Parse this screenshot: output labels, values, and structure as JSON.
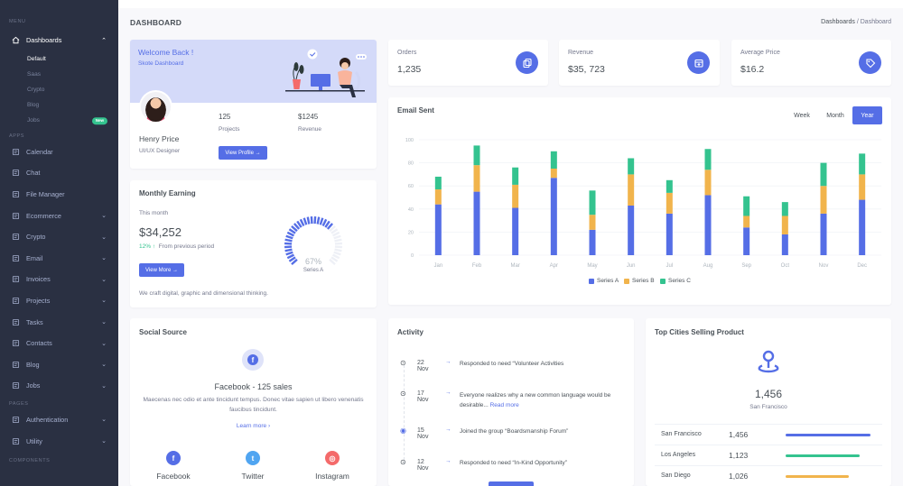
{
  "sidebar": {
    "menu_title": "MENU",
    "apps_title": "APPS",
    "pages_title": "PAGES",
    "components_title": "COMPONENTS",
    "dashboards": {
      "label": "Dashboards",
      "sub": [
        "Default",
        "Saas",
        "Crypto",
        "Blog",
        "Jobs"
      ],
      "new_badge": "New"
    },
    "apps": [
      {
        "label": "Calendar",
        "icon": "calendar-icon",
        "chevron": false
      },
      {
        "label": "Chat",
        "icon": "chat-icon",
        "chevron": false
      },
      {
        "label": "File Manager",
        "icon": "file-icon",
        "chevron": false
      },
      {
        "label": "Ecommerce",
        "icon": "store-icon",
        "chevron": true
      },
      {
        "label": "Crypto",
        "icon": "bitcoin-icon",
        "chevron": true
      },
      {
        "label": "Email",
        "icon": "envelope-icon",
        "chevron": true
      },
      {
        "label": "Invoices",
        "icon": "receipt-icon",
        "chevron": true
      },
      {
        "label": "Projects",
        "icon": "briefcase-icon",
        "chevron": true
      },
      {
        "label": "Tasks",
        "icon": "task-icon",
        "chevron": true
      },
      {
        "label": "Contacts",
        "icon": "contacts-icon",
        "chevron": true
      },
      {
        "label": "Blog",
        "icon": "blog-icon",
        "chevron": true
      },
      {
        "label": "Jobs",
        "icon": "jobs-icon",
        "chevron": true
      }
    ],
    "pages": [
      {
        "label": "Authentication",
        "icon": "user-circle-icon",
        "chevron": true
      },
      {
        "label": "Utility",
        "icon": "utility-icon",
        "chevron": true
      }
    ]
  },
  "header": {
    "title": "DASHBOARD",
    "breadcrumb_root": "Dashboards",
    "breadcrumb_sep": "/",
    "breadcrumb_current": "Dashboard"
  },
  "welcome": {
    "title": "Welcome Back !",
    "subtitle": "Skote Dashboard",
    "name": "Henry Price",
    "role": "UI/UX Designer",
    "projects_value": "125",
    "projects_label": "Projects",
    "revenue_value": "$1245",
    "revenue_label": "Revenue",
    "button": "View Profile"
  },
  "stats": [
    {
      "label": "Orders",
      "value": "1,235",
      "icon": "copy-icon"
    },
    {
      "label": "Revenue",
      "value": "$35, 723",
      "icon": "archive-icon"
    },
    {
      "label": "Average Price",
      "value": "$16.2",
      "icon": "tag-icon"
    }
  ],
  "monthly": {
    "title": "Monthly Earning",
    "period": "This month",
    "amount": "$34,252",
    "change": "12%",
    "change_text": "From previous period",
    "button": "View More",
    "note": "We craft digital, graphic and dimensional thinking.",
    "gauge_value": 67,
    "gauge_label": "67%",
    "gauge_series": "Series A",
    "accent": "#556ee6"
  },
  "email_chart": {
    "title": "Email Sent",
    "tabs": [
      "Week",
      "Month",
      "Year"
    ],
    "selected_tab": "Year"
  },
  "chart_data": {
    "type": "bar",
    "stacked": true,
    "categories": [
      "Jan",
      "Feb",
      "Mar",
      "Apr",
      "May",
      "Jun",
      "Jul",
      "Aug",
      "Sep",
      "Oct",
      "Nov",
      "Dec"
    ],
    "series": [
      {
        "name": "Series A",
        "color": "#556ee6",
        "values": [
          44,
          55,
          41,
          67,
          22,
          43,
          36,
          52,
          24,
          18,
          36,
          48
        ]
      },
      {
        "name": "Series B",
        "color": "#f1b44c",
        "values": [
          13,
          23,
          20,
          8,
          13,
          27,
          18,
          22,
          10,
          16,
          24,
          22
        ]
      },
      {
        "name": "Series C",
        "color": "#34c38f",
        "values": [
          11,
          17,
          15,
          15,
          21,
          14,
          11,
          18,
          17,
          12,
          20,
          18
        ]
      }
    ],
    "yticks": [
      0,
      20,
      40,
      60,
      80,
      100
    ],
    "ylim": [
      0,
      100
    ],
    "grid": true,
    "legend": "bottom"
  },
  "social": {
    "title": "Social Source",
    "headline": "Facebook - 125 sales",
    "text": "Maecenas nec odio et ante tincidunt tempus. Donec vitae sapien ut libero venenatis faucibus tincidunt.",
    "link": "Learn more",
    "networks": [
      {
        "label": "Facebook",
        "icon": "facebook-icon",
        "color": "#556ee6",
        "glyph": "f"
      },
      {
        "label": "Twitter",
        "icon": "twitter-icon",
        "color": "#50a5f1",
        "glyph": "t"
      },
      {
        "label": "Instagram",
        "icon": "instagram-icon",
        "color": "#f46a6a",
        "glyph": "◎"
      }
    ]
  },
  "activity": {
    "title": "Activity",
    "items": [
      {
        "date": "22 Nov",
        "text": "Responded to need “Volunteer Activities",
        "more": ""
      },
      {
        "date": "17 Nov",
        "text": "Everyone realizes why a new common language would be desirable...",
        "more": "Read more"
      },
      {
        "date": "15 Nov",
        "text": "Joined the group “Boardsmanship Forum”",
        "more": ""
      },
      {
        "date": "12 Nov",
        "text": "Responded to need “In-Kind Opportunity”",
        "more": ""
      }
    ]
  },
  "cities": {
    "title": "Top Cities Selling Product",
    "headline_value": "1,456",
    "headline_city": "San Francisco",
    "rows": [
      {
        "city": "San Francisco",
        "value": "1,456",
        "progress": 0.94,
        "color": "#556ee6"
      },
      {
        "city": "Los Angeles",
        "value": "1,123",
        "progress": 0.82,
        "color": "#34c38f"
      },
      {
        "city": "San Diego",
        "value": "1,026",
        "progress": 0.7,
        "color": "#f1b44c"
      }
    ]
  }
}
